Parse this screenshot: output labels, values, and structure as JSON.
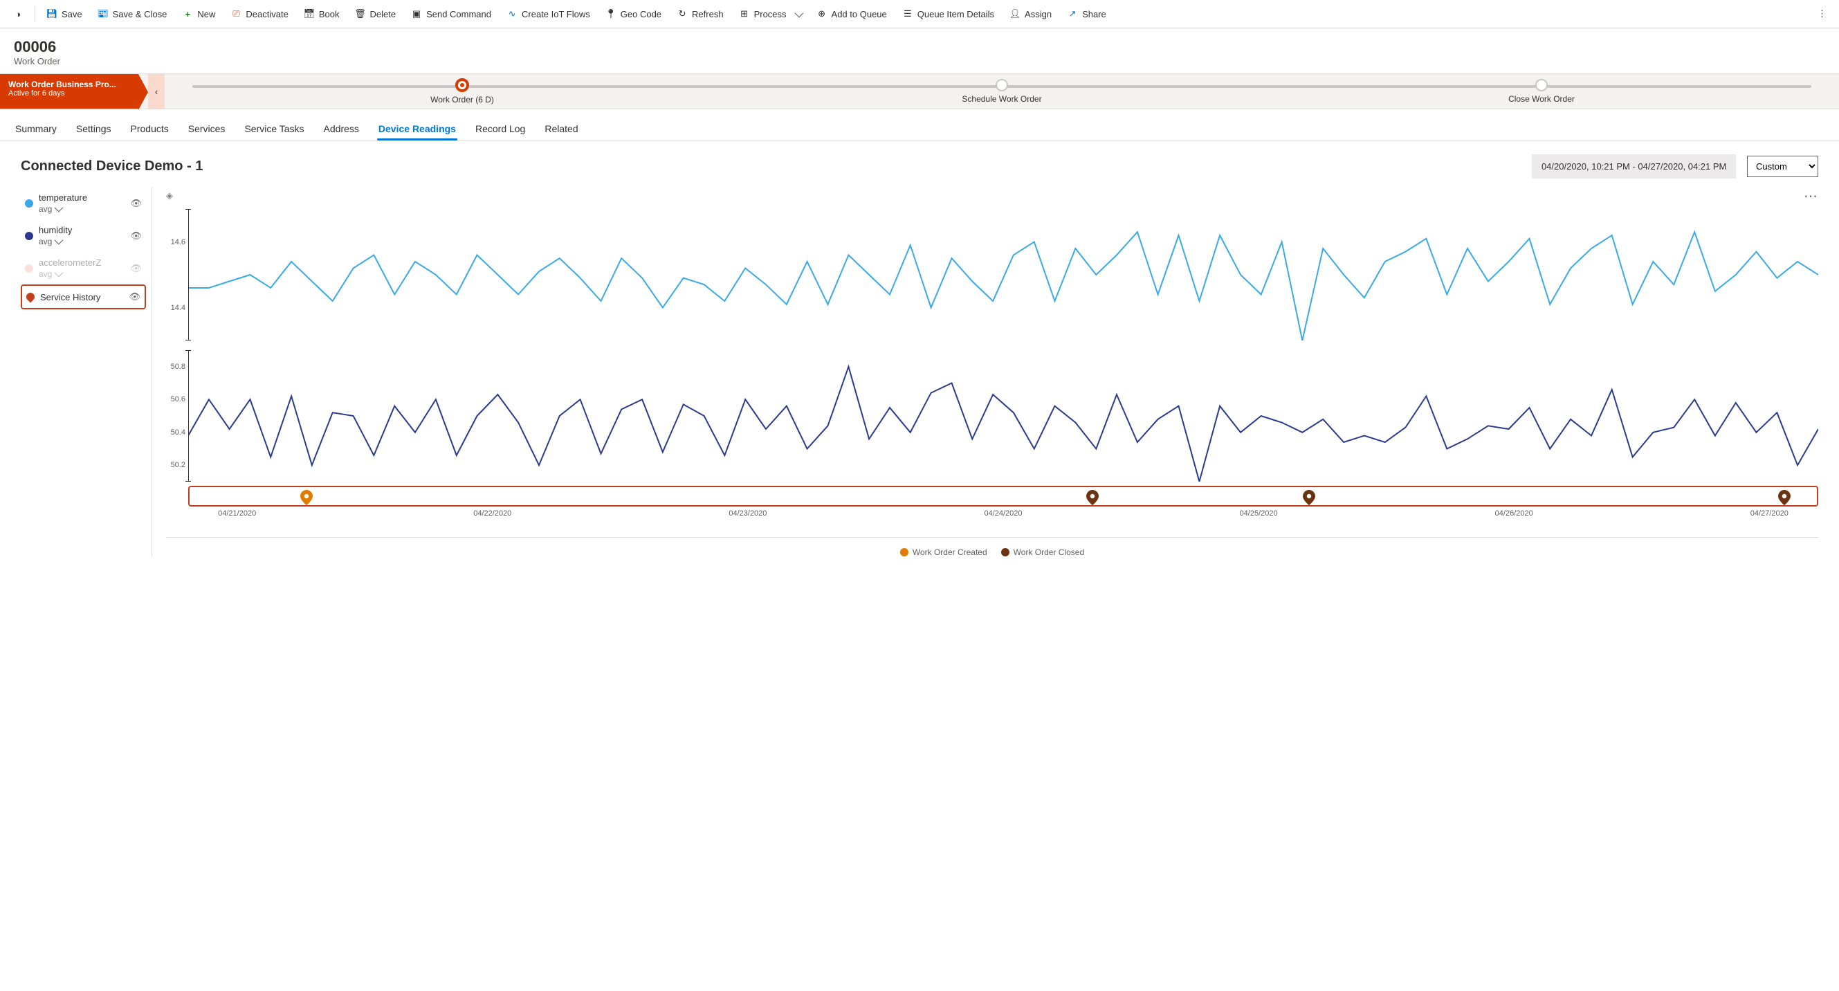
{
  "commands": {
    "save": "Save",
    "save_close": "Save & Close",
    "new": "New",
    "deactivate": "Deactivate",
    "book": "Book",
    "delete": "Delete",
    "send_command": "Send Command",
    "create_iot": "Create IoT Flows",
    "geo_code": "Geo Code",
    "refresh": "Refresh",
    "process": "Process",
    "add_queue": "Add to Queue",
    "queue_details": "Queue Item Details",
    "assign": "Assign",
    "share": "Share"
  },
  "header": {
    "title": "00006",
    "subtitle": "Work Order"
  },
  "bpf": {
    "name": "Work Order Business Pro...",
    "duration": "Active for 6 days",
    "stages": {
      "s1": "Work Order  (6 D)",
      "s2": "Schedule Work Order",
      "s3": "Close Work Order"
    }
  },
  "tabs": {
    "summary": "Summary",
    "settings": "Settings",
    "products": "Products",
    "services": "Services",
    "service_tasks": "Service Tasks",
    "address": "Address",
    "device_readings": "Device Readings",
    "record_log": "Record Log",
    "related": "Related"
  },
  "panel": {
    "title": "Connected Device Demo - 1",
    "range_text": "04/20/2020, 10:21 PM - 04/27/2020, 04:21 PM",
    "range_select": "Custom",
    "range_options": [
      "Custom"
    ]
  },
  "legend": {
    "items": [
      {
        "name": "temperature",
        "agg": "avg",
        "color": "#3aa9e8",
        "enabled": true
      },
      {
        "name": "humidity",
        "agg": "avg",
        "color": "#2b3a8f",
        "enabled": true
      },
      {
        "name": "accelerometerZ",
        "agg": "avg",
        "color": "#f4b6a8",
        "enabled": false
      }
    ],
    "service_history": "Service History"
  },
  "bottom_legend": {
    "created": "Work Order Created",
    "closed": "Work Order Closed"
  },
  "colors": {
    "created": "#e07b00",
    "closed": "#6b3410"
  },
  "chart_data": {
    "type": "line",
    "xlabel": "",
    "title": "",
    "x_categories": [
      "04/21/2020",
      "04/22/2020",
      "04/23/2020",
      "04/24/2020",
      "04/25/2020",
      "04/26/2020",
      "04/27/2020"
    ],
    "series": [
      {
        "name": "temperature",
        "color": "#3aa9e8",
        "ylim": [
          14.3,
          14.7
        ],
        "yticks": [
          14.4,
          14.6
        ],
        "values": [
          14.46,
          14.46,
          14.48,
          14.5,
          14.46,
          14.54,
          14.48,
          14.42,
          14.52,
          14.56,
          14.44,
          14.54,
          14.5,
          14.44,
          14.56,
          14.5,
          14.44,
          14.51,
          14.55,
          14.49,
          14.42,
          14.55,
          14.49,
          14.4,
          14.49,
          14.47,
          14.42,
          14.52,
          14.47,
          14.41,
          14.54,
          14.41,
          14.56,
          14.5,
          14.44,
          14.59,
          14.4,
          14.55,
          14.48,
          14.42,
          14.56,
          14.6,
          14.42,
          14.58,
          14.5,
          14.56,
          14.63,
          14.44,
          14.62,
          14.42,
          14.62,
          14.5,
          14.44,
          14.6,
          14.3,
          14.58,
          14.5,
          14.43,
          14.54,
          14.57,
          14.61,
          14.44,
          14.58,
          14.48,
          14.54,
          14.61,
          14.41,
          14.52,
          14.58,
          14.62,
          14.41,
          14.54,
          14.47,
          14.63,
          14.45,
          14.5,
          14.57,
          14.49,
          14.54,
          14.5
        ]
      },
      {
        "name": "humidity",
        "color": "#2b3a8f",
        "ylim": [
          50.1,
          50.9
        ],
        "yticks": [
          50.2,
          50.4,
          50.6,
          50.8
        ],
        "values": [
          50.38,
          50.6,
          50.42,
          50.6,
          50.25,
          50.62,
          50.2,
          50.52,
          50.5,
          50.26,
          50.56,
          50.4,
          50.6,
          50.26,
          50.5,
          50.63,
          50.46,
          50.2,
          50.5,
          50.6,
          50.27,
          50.54,
          50.6,
          50.28,
          50.57,
          50.5,
          50.26,
          50.6,
          50.42,
          50.56,
          50.3,
          50.44,
          50.8,
          50.36,
          50.55,
          50.4,
          50.64,
          50.7,
          50.36,
          50.63,
          50.52,
          50.3,
          50.56,
          50.46,
          50.3,
          50.63,
          50.34,
          50.48,
          50.56,
          50.1,
          50.56,
          50.4,
          50.5,
          50.46,
          50.4,
          50.48,
          50.34,
          50.38,
          50.34,
          50.43,
          50.62,
          50.3,
          50.36,
          50.44,
          50.42,
          50.55,
          50.3,
          50.48,
          50.38,
          50.66,
          50.25,
          50.4,
          50.43,
          50.6,
          50.38,
          50.58,
          50.4,
          50.52,
          50.2,
          50.42
        ]
      }
    ],
    "annotations": {
      "service_history_markers": [
        {
          "x_frac": 0.072,
          "type": "created"
        },
        {
          "x_frac": 0.555,
          "type": "closed"
        },
        {
          "x_frac": 0.688,
          "type": "closed"
        },
        {
          "x_frac": 0.98,
          "type": "closed"
        }
      ]
    }
  }
}
